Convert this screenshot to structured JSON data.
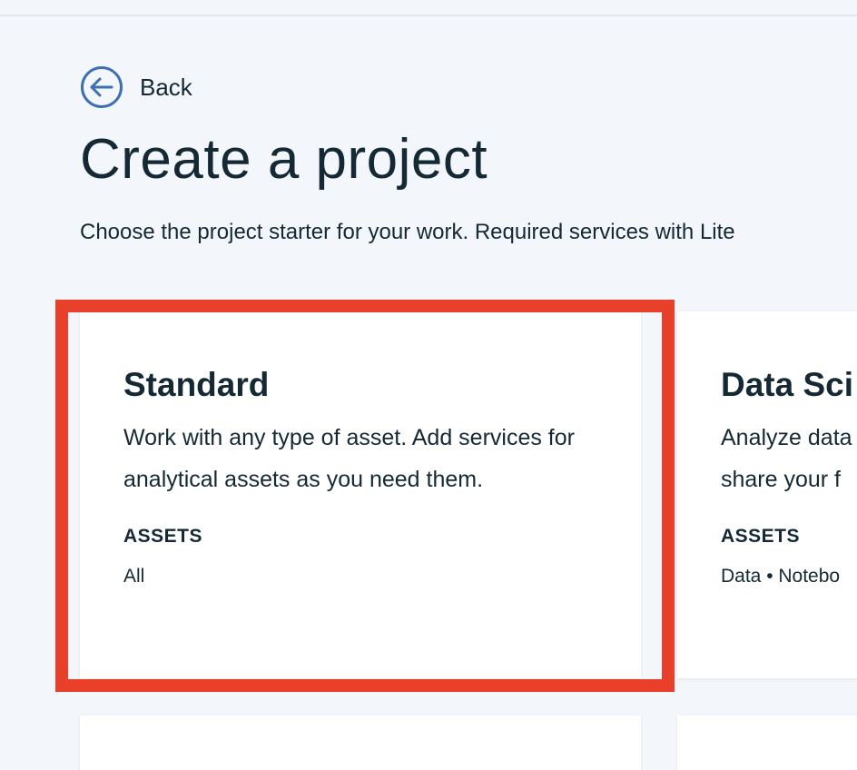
{
  "back": {
    "label": "Back",
    "icon": "arrow-left-circle-icon"
  },
  "page": {
    "title": "Create a project",
    "subtitle": "Choose the project starter for your work. Required services with Lite"
  },
  "cards": [
    {
      "title": "Standard",
      "description": "Work with any type of asset. Add services for analytical assets as you need them.",
      "assets_heading": "ASSETS",
      "assets_value": "All"
    },
    {
      "title": "Data Sci",
      "description": "Analyze data\nshare your f",
      "assets_heading": "ASSETS",
      "assets_value": "Data • Notebo"
    }
  ],
  "colors": {
    "background": "#f3f6fa",
    "card": "#ffffff",
    "text": "#152935",
    "accent_blue": "#3d70b2",
    "highlight_red": "#e8402a"
  }
}
